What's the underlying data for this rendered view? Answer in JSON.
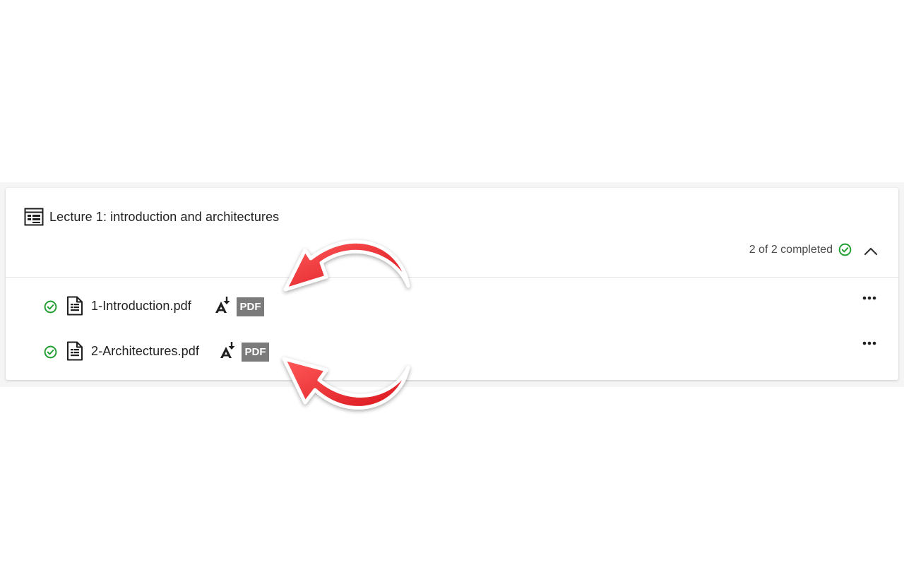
{
  "module": {
    "title": "Lecture 1: introduction and architectures",
    "icon": "module-list-icon",
    "progress_text": "2 of 2 completed",
    "progress_icon": "check-circle-icon",
    "collapse_icon": "chevron-up-icon"
  },
  "items": [
    {
      "label": "1-Introduction.pdf",
      "status_icon": "check-circle-icon",
      "type_icon": "document-icon",
      "action_icon": "acrobat-download-icon",
      "badge": "PDF",
      "menu_icon": "more-horizontal-icon"
    },
    {
      "label": "2-Architectures.pdf",
      "status_icon": "check-circle-icon",
      "type_icon": "document-icon",
      "action_icon": "acrobat-download-icon",
      "badge": "PDF",
      "menu_icon": "more-horizontal-icon"
    }
  ],
  "colors": {
    "success": "#1f9d2f",
    "badge_bg": "#7b7b7b",
    "annotation_arrow": "#e8262c",
    "text": "#1f1f1f",
    "divider": "#e3e3e3"
  }
}
